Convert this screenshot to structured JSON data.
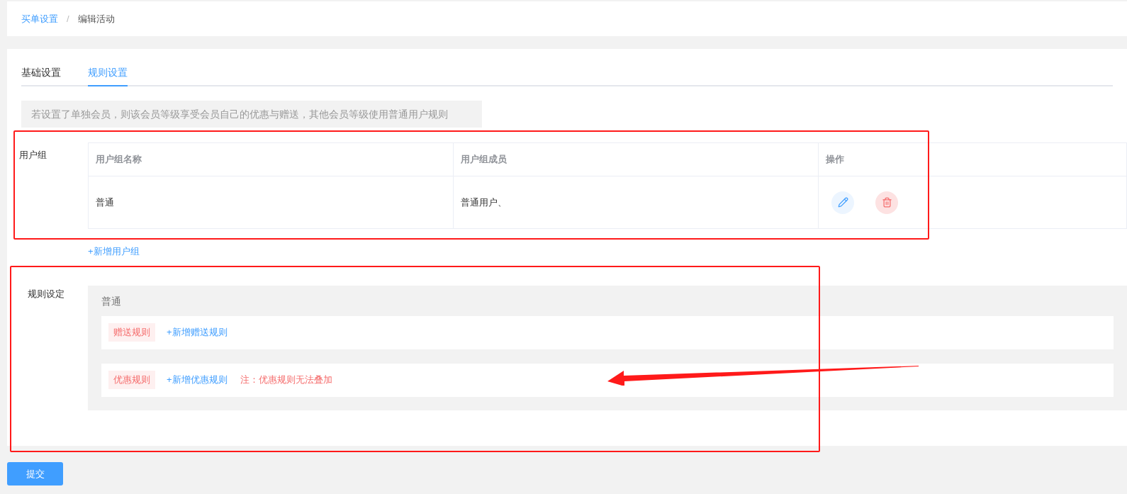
{
  "breadcrumb": [
    {
      "label": "买单设置",
      "kind": "link"
    },
    {
      "label": "编辑活动",
      "kind": "current"
    }
  ],
  "breadcrumb_separator": "/",
  "tabs": [
    {
      "label": "基础设置",
      "selected": false
    },
    {
      "label": "规则设置",
      "selected": true
    }
  ],
  "notice": "若设置了单独会员，则该会员等级享受会员自己的优惠与赠送，其他会员等级使用普通用户规则",
  "user_group": {
    "label": "用户组",
    "columns": [
      "用户组名称",
      "用户组成员",
      "操作"
    ],
    "rows": [
      {
        "name": "普通",
        "members": "普通用户、"
      }
    ],
    "add_link": "+新增用户组"
  },
  "rule_setting": {
    "label": "规则设定",
    "group_name": "普通",
    "rules": [
      {
        "tag": "赠送规则",
        "add_link": "+新增赠送规则"
      },
      {
        "tag": "优惠规则",
        "add_link": "+新增优惠规则",
        "note": "注：优惠规则无法叠加"
      }
    ]
  },
  "submit": "提交"
}
